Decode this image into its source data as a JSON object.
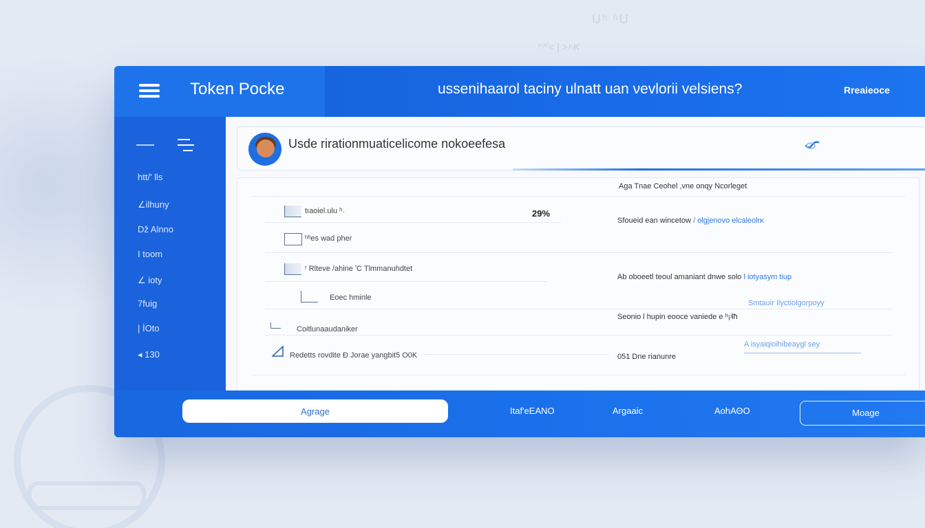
{
  "background": {
    "ghost_top": "Uʰ ʱU",
    "ghost_sub": "ʰˀˁ˂ | ˃˄K"
  },
  "header": {
    "app_title": "Token Pocke",
    "title": "ussenihaarol taciny ulnatt uan νevlorii velsiens?",
    "action": "Rreaieoce"
  },
  "sidebar": {
    "items": [
      {
        "label": "htt/'  lls"
      },
      {
        "label": "∠ilhuny"
      },
      {
        "label": "ǅ Alnno"
      },
      {
        "label": "I toom"
      },
      {
        "label": "∠ ioty"
      },
      {
        "label": "7fuig"
      },
      {
        "label": "| İOto"
      },
      {
        "label": "◂ 130"
      }
    ]
  },
  "user_card": {
    "name": "Usde rirationmuaticelicome nokoeefesa",
    "progress": 0.6
  },
  "table": {
    "right_header": "Aga Tnae Ceohel  ,vne  onqy  Ncorleget",
    "rows": [
      {
        "left": "tıaoiel.ulu ʰ˒",
        "value": "29%",
        "right": "Sfoueid ean  wincetow",
        "right_link": "/ olgjenovo elcaleolrĸ"
      },
      {
        "left": "ʰʱes wad pher",
        "value": "",
        "right": "",
        "right_link": ""
      },
      {
        "left": "ʳ Rlteve  /ahine  ʹC  Tlmmanuhdtet",
        "value": "",
        "right": "Ab oboeetl  teoul amaniant dnwe  solo",
        "right_link": "l iotyasym tiup"
      },
      {
        "left": "Eoec hminle",
        "value": "",
        "right": "",
        "right_link": ""
      },
      {
        "left": "Coitlunaaudaniker",
        "value": "",
        "right": "Seonio l  hupin  eooce  vaniede  e ʰ¡ʲlħ",
        "right_link": ""
      },
      {
        "left": "Redetts rovdite  Ð Jorae  yangbit5 O0K",
        "value": "",
        "right": "051  Dne  rianunre",
        "right_link": ""
      }
    ],
    "side_links": [
      "Smtauir  Ilyctiolgorpoyy",
      "A isyaiqioihibeaygl sey"
    ]
  },
  "footer": {
    "primary": "Agrage",
    "link1": "Itaf'eEANO",
    "link2": "Argaaic",
    "link3": "AohΑΘO",
    "outline": "Moage"
  },
  "colors": {
    "brand": "#1a6fe6",
    "sidebar": "#1a63dc",
    "content_bg": "#f7f9fd"
  }
}
